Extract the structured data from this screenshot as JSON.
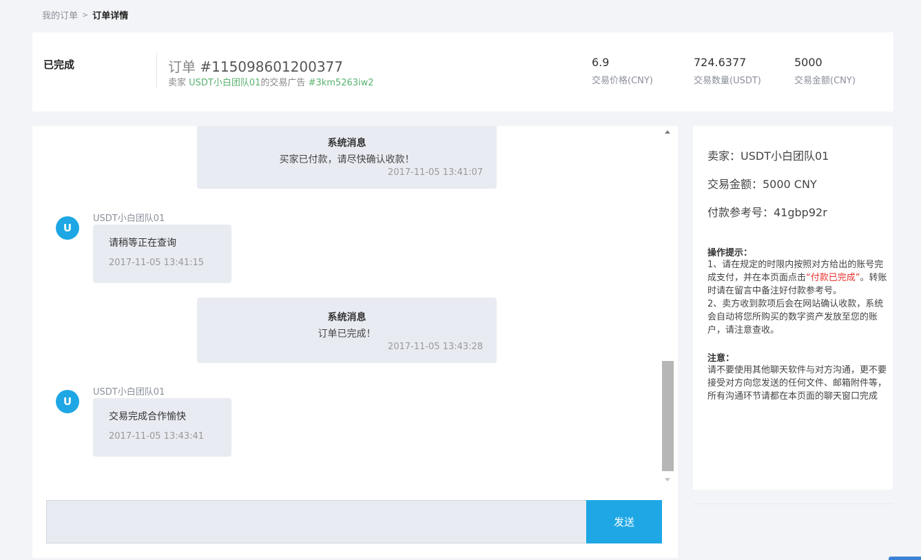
{
  "breadcrumb": {
    "parent": "我的订单",
    "separator": ">",
    "current": "订单详情"
  },
  "order": {
    "status": "已完成",
    "title_prefix": "订单",
    "number": "#115098601200377",
    "seller_prefix": "卖家",
    "seller_name": "USDT小白团队01",
    "ad_mid": "的交易广告",
    "ad_code": "#3km5263iw2",
    "stats": [
      {
        "value": "6.9",
        "label": "交易价格(CNY)"
      },
      {
        "value": "724.6377",
        "label": "交易数量(USDT)"
      },
      {
        "value": "5000",
        "label": "交易金额(CNY)"
      }
    ]
  },
  "chat": {
    "messages": [
      {
        "type": "system",
        "title": "系统消息",
        "body": "买家已付款，请尽快确认收款！",
        "time": "2017-11-05 13:41:07"
      },
      {
        "type": "user",
        "avatar": "U",
        "name": "USDT小白团队01",
        "body": "请稍等正在查询",
        "time": "2017-11-05 13:41:15"
      },
      {
        "type": "system",
        "title": "系统消息",
        "body": "订单已完成！",
        "time": "2017-11-05 13:43:28"
      },
      {
        "type": "user",
        "avatar": "U",
        "name": "USDT小白团队01",
        "body": "交易完成合作愉快",
        "time": "2017-11-05 13:43:41"
      }
    ],
    "input_value": "",
    "send_label": "发送"
  },
  "side": {
    "seller": "卖家：USDT小白团队01",
    "amount": "交易金额：5000 CNY",
    "ref": "付款参考号：41gbp92r",
    "tips_title": "操作提示：",
    "tips_1": "1、请在规定的时限内按照对方给出的账号完成支付，并在本页面点击",
    "tips_highlight": "“付款已完成”",
    "tips_2": "。转账时请在留言中备注好付款参考号。",
    "tips_3": "2、卖方收到款项后会在网站确认收款，系统会自动将您所购买的数字资产发放至您的账户，请注意查收。",
    "warn_title": "注意：",
    "warn_body": "请不要使用其他聊天软件与对方沟通，更不要接受对方向您发送的任何文件、邮箱附件等，所有沟通环节请都在本页面的聊天窗口完成"
  },
  "colors": {
    "accent": "#1ea7e4",
    "green": "#58b26e",
    "red": "#e8302a",
    "bubble": "#e9ebf2"
  }
}
